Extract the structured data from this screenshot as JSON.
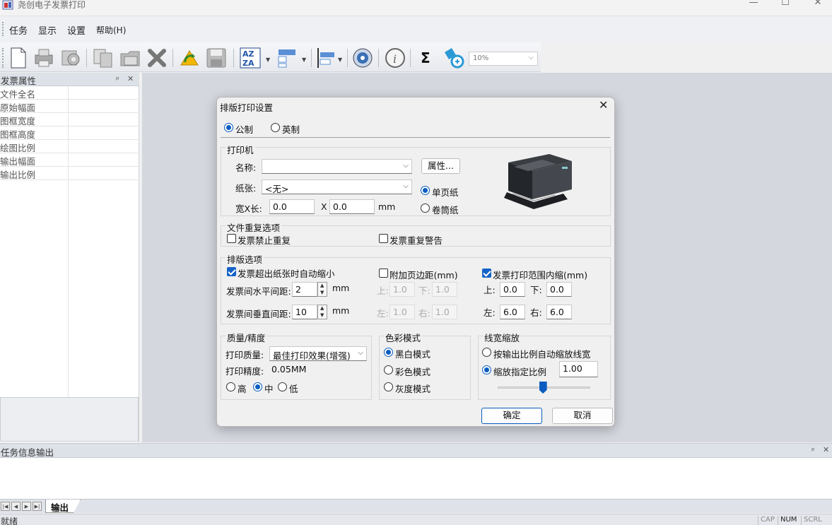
{
  "window": {
    "title": "尧创电子发票打印",
    "minimize": "—",
    "maximize": "☐",
    "close": "✕"
  },
  "menu": {
    "items": [
      "任务",
      "显示",
      "设置",
      "帮助(H)"
    ]
  },
  "toolbar": {
    "icons": [
      "new-document-icon",
      "print-icon",
      "print-setup-icon",
      "copy-icon",
      "paste-icon",
      "delete-icon",
      "refresh-icon",
      "save-icon",
      "sort-icon",
      "layout-icon",
      "align-icon",
      "settings-icon",
      "info-icon",
      "sum-icon",
      "zoom-icon"
    ],
    "sum_glyph": "Σ",
    "zoom_value": "10%"
  },
  "property_panel": {
    "title": "发票属性",
    "pin": "ᵖ",
    "close": "✕",
    "rows": [
      "文件全名",
      "原始幅面",
      "图框宽度",
      "图框高度",
      "绘图比例",
      "输出幅面",
      "输出比例"
    ]
  },
  "output_panel": {
    "title": "任务信息输出",
    "pin": "ᵖ",
    "close": "✕",
    "tab": "输出"
  },
  "status": {
    "text": "就绪",
    "indicators": [
      "CAP",
      "NUM",
      "SCRL"
    ]
  },
  "dialog": {
    "title": "排版打印设置",
    "close": "✕",
    "units": {
      "metric": "公制",
      "imperial": "英制",
      "selected": "metric"
    },
    "printer": {
      "group": "打印机",
      "name_label": "名称:",
      "name_value": "",
      "properties_button": "属性...",
      "paper_label": "纸张:",
      "paper_value": "<无>",
      "size_label": "宽X长:",
      "width": "0.0",
      "x": "X",
      "height": "0.0",
      "unit": "mm",
      "single_sheet": "单页纸",
      "roll_paper": "卷筒纸",
      "paper_mode": "single"
    },
    "duplicate": {
      "group": "文件重复选项",
      "forbid": "发票禁止重复",
      "forbid_checked": false,
      "warn": "发票重复警告",
      "warn_checked": false
    },
    "layout": {
      "group": "排版选项",
      "auto_shrink": "发票超出纸张时自动缩小",
      "auto_shrink_checked": true,
      "h_gap_label": "发票间水平间距:",
      "h_gap": "2",
      "v_gap_label": "发票间垂直间距:",
      "v_gap": "10",
      "mm": "mm",
      "margin": "附加页边距(mm)",
      "margin_checked": false,
      "margin_top_label": "上:",
      "margin_top": "1.0",
      "margin_bottom_label": "下:",
      "margin_bottom": "1.0",
      "margin_left_label": "左:",
      "margin_left": "1.0",
      "margin_right_label": "右:",
      "margin_right": "1.0",
      "inset": "发票打印范围内缩(mm)",
      "inset_checked": true,
      "inset_top_label": "上:",
      "inset_top": "0.0",
      "inset_bottom_label": "下:",
      "inset_bottom": "0.0",
      "inset_left_label": "左:",
      "inset_left": "6.0",
      "inset_right_label": "右:",
      "inset_right": "6.0"
    },
    "quality": {
      "group": "质量/精度",
      "quality_label": "打印质量:",
      "quality_value": "最佳打印效果(增强)",
      "precision_label": "打印精度:",
      "precision_value": "0.05MM",
      "high": "高",
      "mid": "中",
      "low": "低",
      "selected": "mid"
    },
    "color": {
      "group": "色彩模式",
      "bw": "黑白模式",
      "color": "彩色模式",
      "gray": "灰度模式",
      "selected": "bw"
    },
    "linewidth": {
      "group": "线宽缩放",
      "auto": "按输出比例自动缩放线宽",
      "custom": "缩放指定比例",
      "value": "1.00",
      "selected": "custom",
      "slider_level": 0.49
    },
    "ok": "确定",
    "cancel": "取消"
  }
}
